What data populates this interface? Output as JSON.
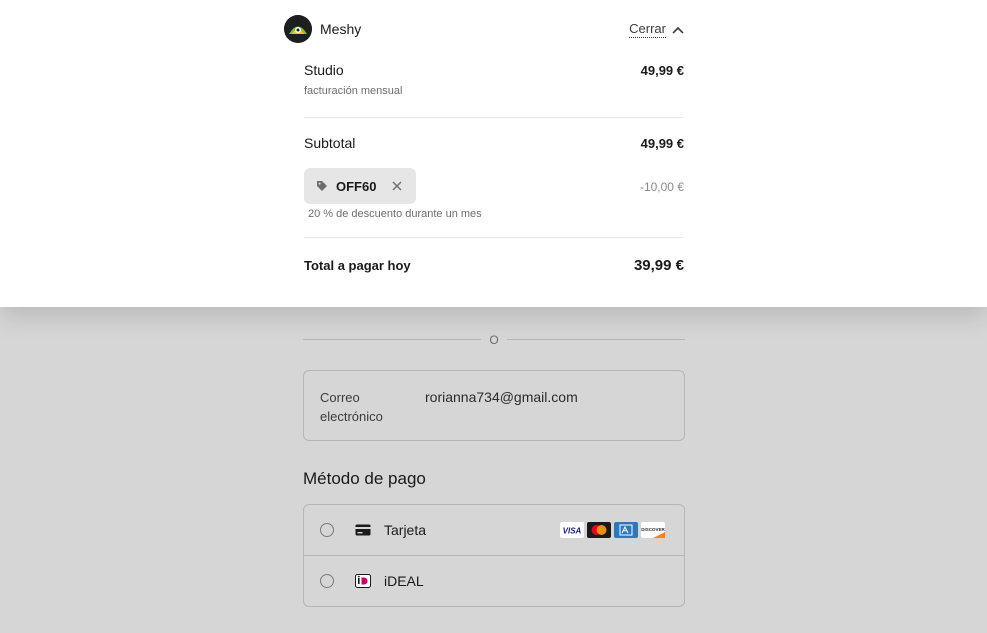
{
  "summary": {
    "brand_name": "Meshy",
    "close_label": "Cerrar",
    "plan": {
      "name": "Studio",
      "billing": "facturación mensual",
      "price": "49,99 €"
    },
    "subtotal": {
      "label": "Subtotal",
      "amount": "49,99 €"
    },
    "promo": {
      "code": "OFF60",
      "discount": "-10,00 €",
      "description": "20 % de descuento durante un mes"
    },
    "total": {
      "label": "Total a pagar hoy",
      "amount": "39,99 €"
    }
  },
  "form": {
    "separator_text": "O",
    "email": {
      "label": "Correo electrónico",
      "value": "rorianna734@gmail.com"
    },
    "payment_method": {
      "heading": "Método de pago",
      "options": [
        {
          "label": "Tarjeta",
          "icon": "card-icon",
          "logos": [
            "VISA",
            "mastercard",
            "amex",
            "DISCOVER"
          ]
        },
        {
          "label": "iDEAL",
          "icon": "ideal-icon"
        }
      ]
    }
  },
  "colors": {
    "overlay_background": "#d6d6d6",
    "panel_background": "#ffffff",
    "ideal_pink": "#cc0066",
    "visa_blue": "#1a1f71",
    "amex_blue": "#2e77bc",
    "discover_orange": "#f58220"
  }
}
